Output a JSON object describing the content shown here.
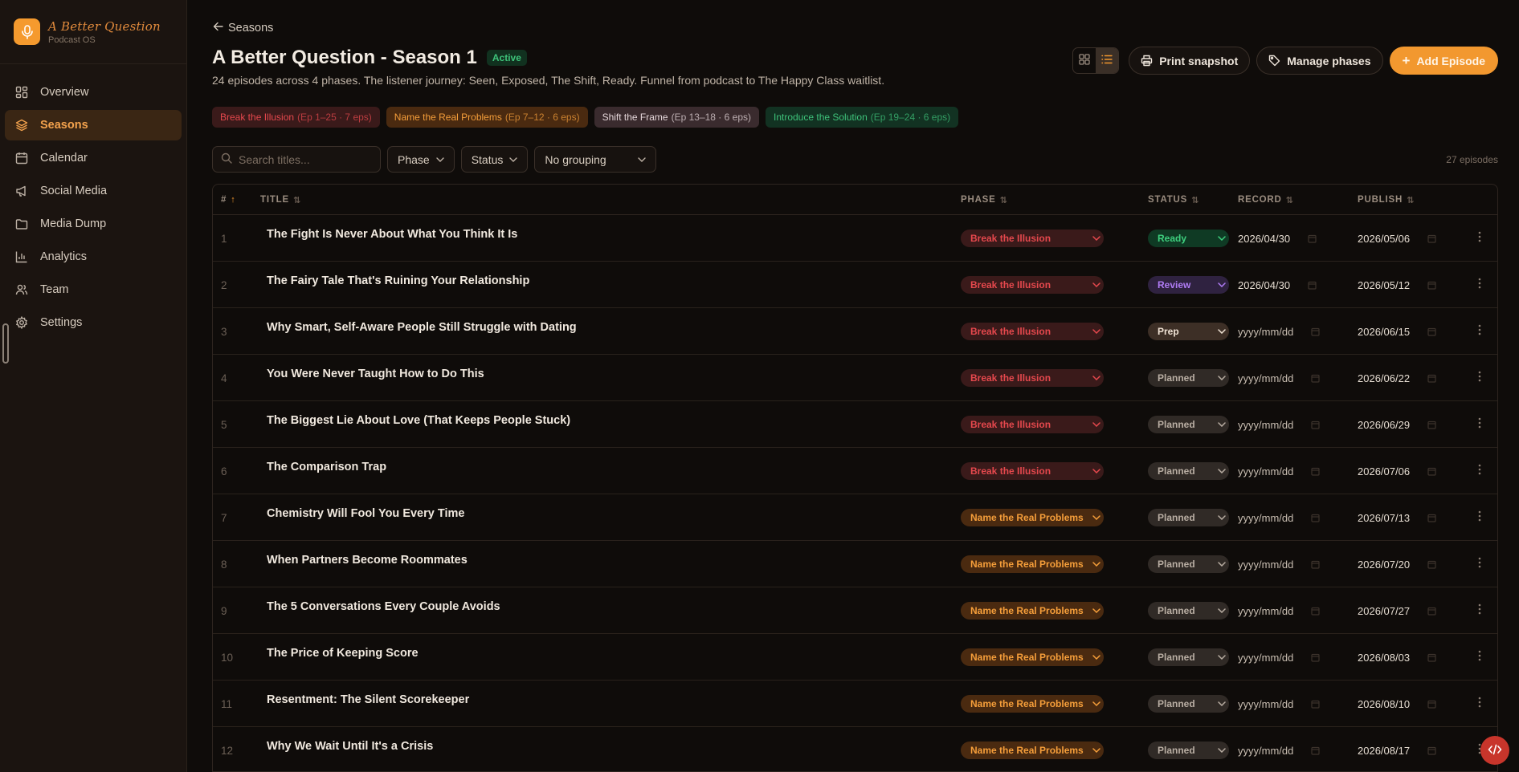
{
  "brand": {
    "name": "A Better Question",
    "sub": "Podcast OS"
  },
  "sidebar": {
    "items": [
      {
        "label": "Overview",
        "icon": "grid-icon",
        "active": false
      },
      {
        "label": "Seasons",
        "icon": "layers-icon",
        "active": true
      },
      {
        "label": "Calendar",
        "icon": "calendar-icon",
        "active": false
      },
      {
        "label": "Social Media",
        "icon": "megaphone-icon",
        "active": false
      },
      {
        "label": "Media Dump",
        "icon": "folder-icon",
        "active": false
      },
      {
        "label": "Analytics",
        "icon": "bar-chart-icon",
        "active": false
      },
      {
        "label": "Team",
        "icon": "users-icon",
        "active": false
      },
      {
        "label": "Settings",
        "icon": "gear-icon",
        "active": false
      }
    ]
  },
  "header": {
    "back_label": "Seasons",
    "title": "A Better Question - Season 1",
    "badge": "Active",
    "description": "24 episodes across 4 phases. The listener journey: Seen, Exposed, The Shift, Ready. Funnel from podcast to The Happy Class waitlist."
  },
  "actions": {
    "print_label": "Print snapshot",
    "manage_label": "Manage phases",
    "add_label": "Add Episode"
  },
  "phases": [
    {
      "name": "Break the Illusion",
      "meta": "(Ep 1–25 · 7 eps)"
    },
    {
      "name": "Name the Real Problems",
      "meta": "(Ep 7–12 · 6 eps)"
    },
    {
      "name": "Shift the Frame",
      "meta": "(Ep 13–18 · 6 eps)"
    },
    {
      "name": "Introduce the Solution",
      "meta": "(Ep 19–24 · 6 eps)"
    }
  ],
  "filters": {
    "search_placeholder": "Search titles...",
    "phase_label": "Phase",
    "status_label": "Status",
    "grouping_label": "No grouping",
    "count": "27 episodes"
  },
  "table": {
    "headers": {
      "num": "#",
      "title": "TITLE",
      "phase": "PHASE",
      "status": "STATUS",
      "record": "RECORD",
      "publish": "PUBLISH"
    },
    "rows": [
      {
        "num": "1",
        "title": "The Fight Is Never About What You Think It Is",
        "phase": "Break the Illusion",
        "status": "Ready",
        "record": "2026/04/30",
        "publish": "2026/05/06"
      },
      {
        "num": "2",
        "title": "The Fairy Tale That's Ruining Your Relationship",
        "phase": "Break the Illusion",
        "status": "Review",
        "record": "2026/04/30",
        "publish": "2026/05/12"
      },
      {
        "num": "3",
        "title": "Why Smart, Self-Aware People Still Struggle with Dating",
        "phase": "Break the Illusion",
        "status": "Prep",
        "record": "yyyy/mm/dd",
        "publish": "2026/06/15"
      },
      {
        "num": "4",
        "title": "You Were Never Taught How to Do This",
        "phase": "Break the Illusion",
        "status": "Planned",
        "record": "yyyy/mm/dd",
        "publish": "2026/06/22"
      },
      {
        "num": "5",
        "title": "The Biggest Lie About Love (That Keeps People Stuck)",
        "phase": "Break the Illusion",
        "status": "Planned",
        "record": "yyyy/mm/dd",
        "publish": "2026/06/29"
      },
      {
        "num": "6",
        "title": "The Comparison Trap",
        "phase": "Break the Illusion",
        "status": "Planned",
        "record": "yyyy/mm/dd",
        "publish": "2026/07/06"
      },
      {
        "num": "7",
        "title": "Chemistry Will Fool You Every Time",
        "phase": "Name the Real Problems",
        "status": "Planned",
        "record": "yyyy/mm/dd",
        "publish": "2026/07/13"
      },
      {
        "num": "8",
        "title": "When Partners Become Roommates",
        "phase": "Name the Real Problems",
        "status": "Planned",
        "record": "yyyy/mm/dd",
        "publish": "2026/07/20"
      },
      {
        "num": "9",
        "title": "The 5 Conversations Every Couple Avoids",
        "phase": "Name the Real Problems",
        "status": "Planned",
        "record": "yyyy/mm/dd",
        "publish": "2026/07/27"
      },
      {
        "num": "10",
        "title": "The Price of Keeping Score",
        "phase": "Name the Real Problems",
        "status": "Planned",
        "record": "yyyy/mm/dd",
        "publish": "2026/08/03"
      },
      {
        "num": "11",
        "title": "Resentment: The Silent Scorekeeper",
        "phase": "Name the Real Problems",
        "status": "Planned",
        "record": "yyyy/mm/dd",
        "publish": "2026/08/10"
      },
      {
        "num": "12",
        "title": "Why We Wait Until It's a Crisis",
        "phase": "Name the Real Problems",
        "status": "Planned",
        "record": "yyyy/mm/dd",
        "publish": "2026/08/17"
      }
    ]
  },
  "colors": {
    "accent": "#f2982f",
    "phase_illusion_bg": "#3a1a1a",
    "phase_illusion_fg": "#e5484d",
    "phase_problems_bg": "#4a2a10",
    "phase_problems_fg": "#f59e3a",
    "phase_frame_bg": "#3a2b2e",
    "phase_frame_fg": "#e4d6d9",
    "phase_solution_bg": "#123222",
    "phase_solution_fg": "#3ec27a",
    "status_ready_bg": "#0f3a24",
    "status_ready_fg": "#3ecf7e",
    "status_review_bg": "#2f2240",
    "status_review_fg": "#b07cf5",
    "status_prep_bg": "#3d2f26",
    "status_prep_fg": "#f0e3d5",
    "status_planned_bg": "#302a26",
    "status_planned_fg": "#b9aea3"
  }
}
